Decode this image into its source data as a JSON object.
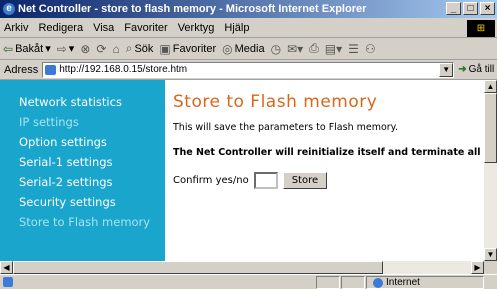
{
  "window": {
    "title": "Net Controller - store to flash memory - Microsoft Internet Explorer"
  },
  "menubar": {
    "items": [
      "Arkiv",
      "Redigera",
      "Visa",
      "Favoriter",
      "Verktyg",
      "Hjälp"
    ]
  },
  "toolbar": {
    "back_label": "Bakåt",
    "search_label": "Sök",
    "favorites_label": "Favoriter",
    "media_label": "Media"
  },
  "address": {
    "label": "Adress",
    "url": "http://192.168.0.15/store.htm",
    "go_label": "Gå till"
  },
  "sidebar": {
    "items": [
      {
        "label": "Network statistics"
      },
      {
        "label": "IP settings"
      },
      {
        "label": "Option settings"
      },
      {
        "label": "Serial-1 settings"
      },
      {
        "label": "Serial-2 settings"
      },
      {
        "label": "Security settings"
      },
      {
        "label": "Store to Flash memory"
      }
    ]
  },
  "main": {
    "title": "Store to Flash memory",
    "description": "This will save the parameters to Flash memory.",
    "warning": "The Net Controller will reinitialize itself and terminate all calls",
    "confirm_label": "Confirm yes/no",
    "confirm_value": "",
    "store_button": "Store"
  },
  "statusbar": {
    "zone": "Internet"
  },
  "colors": {
    "sidebar_bg": "#1aa5cc",
    "title_color": "#d9661a"
  }
}
